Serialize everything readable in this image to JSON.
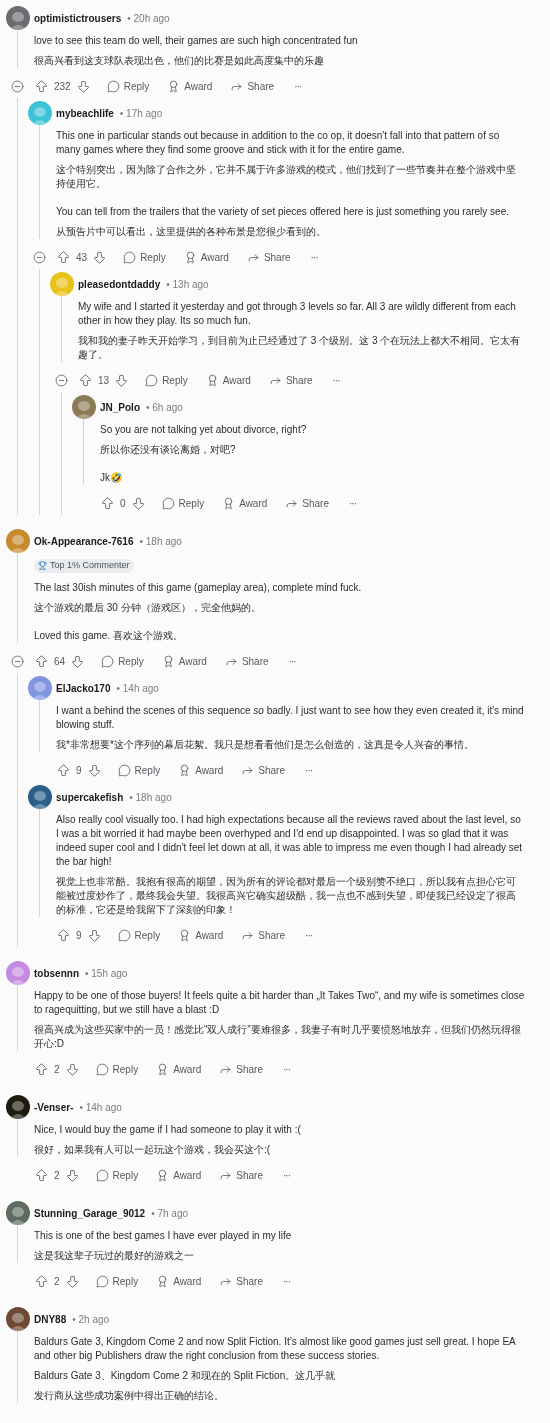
{
  "comments": [
    {
      "user": "optimistictrousers",
      "time": "• 20h ago",
      "color": "#6b6b70",
      "body": [
        [
          "love to see this team do well, their games are such high concentrated fun",
          "很高兴看到这支球队表现出色，他们的比赛是如此高度集中的乐趣"
        ]
      ],
      "actions": {
        "votes": "232",
        "reply": "Reply",
        "award": "Award",
        "share": "Share",
        "more": "···"
      },
      "expanded": true,
      "children": [
        {
          "user": "mybeachlife",
          "time": "• 17h ago",
          "color": "#3cc3d6",
          "body": [
            [
              "This one in particular stands out because in addition to the co op, it doesn't fall into that pattern of so many games where they find some groove and stick with it for the entire game.",
              "这个特别突出，因为除了合作之外，它并不属于许多游戏的模式，他们找到了一些节奏并在整个游戏中坚持使用它。"
            ],
            [
              "You can tell from the trailers that the variety of set pieces offered here is just something you rarely see.",
              "从预告片中可以看出，这里提供的各种布景是您很少看到的。"
            ]
          ],
          "actions": {
            "votes": "43",
            "reply": "Reply",
            "award": "Award",
            "share": "Share",
            "more": "···"
          },
          "expanded": true,
          "children": [
            {
              "user": "pleasedontdaddy",
              "time": "• 13h ago",
              "color": "#e8c21a",
              "body": [
                [
                  "My wife and I started it yesterday and got through 3 levels so far. All 3 are wildly different from each other in how they play. Its so much fun.",
                  "我和我的妻子昨天开始学习，到目前为止已经通过了 3 个级别。这 3 个在玩法上都大不相同。它太有趣了。"
                ]
              ],
              "actions": {
                "votes": "13",
                "reply": "Reply",
                "award": "Award",
                "share": "Share",
                "more": "···"
              },
              "expanded": true,
              "children": [
                {
                  "user": "JN_Polo",
                  "time": "• 6h ago",
                  "color": "#8a7a55",
                  "body": [
                    [
                      "So you are not talking yet about divorce, right?",
                      "所以你还没有谈论离婚，对吧?"
                    ],
                    [
                      "Jk🤣"
                    ]
                  ],
                  "actions": {
                    "votes": "0",
                    "reply": "Reply",
                    "award": "Award",
                    "share": "Share",
                    "more": "···"
                  }
                }
              ]
            }
          ]
        }
      ]
    },
    {
      "user": "Ok-Appearance-7616",
      "time": "• 18h ago",
      "color": "#c98a2e",
      "badge": "Top 1% Commenter",
      "body": [
        [
          "The last 30ish minutes of this game (gameplay area), complete mind fuck.",
          "这个游戏的最后 30 分钟（游戏区），完全他妈的。"
        ],
        [
          "Loved this game.   喜欢这个游戏。"
        ]
      ],
      "actions": {
        "votes": "64",
        "reply": "Reply",
        "award": "Award",
        "share": "Share",
        "more": "···"
      },
      "expanded": true,
      "children": [
        {
          "user": "ElJacko170",
          "time": "• 14h ago",
          "color": "#7f95e0",
          "body": [
            [
              "I want a behind the scenes of this sequence *so* badly. I just want to see how they even created it, it's mind blowing stuff.",
              "我*非常想要*这个序列的幕后花絮。我只是想看看他们是怎么创造的，这真是令人兴奋的事情。"
            ]
          ],
          "actions": {
            "votes": "9",
            "reply": "Reply",
            "award": "Award",
            "share": "Share",
            "more": "···"
          }
        },
        {
          "user": "supercakefish",
          "time": "• 18h ago",
          "color": "#2b5f8a",
          "body": [
            [
              "Also really cool visually too. I had high expectations because all the reviews raved about the last level, so I was a bit worried it had maybe been overhyped and I'd end up disappointed. I was so glad that it was indeed super cool and I didn't feel let down at all, it was able to impress me even though I had already set the bar high!",
              "视觉上也非常酷。我抱有很高的期望，因为所有的评论都对最后一个级别赞不绝口，所以我有点担心它可能被过度炒作了，最终我会失望。我很高兴它确实超级酷，我一点也不感到失望，即使我已经设定了很高的标准，它还是给我留下了深刻的印象！"
            ]
          ],
          "actions": {
            "votes": "9",
            "reply": "Reply",
            "award": "Award",
            "share": "Share",
            "more": "···"
          }
        }
      ]
    },
    {
      "user": "tobsennn",
      "time": "• 15h ago",
      "color": "#c58be0",
      "body": [
        [
          "Happy to be one of those buyers! It feels quite a bit harder than „It Takes Two“, and my wife is sometimes close to ragequitting, but we still have a blast :D",
          "很高兴成为这些买家中的一员！感觉比“双人成行”要难很多，我妻子有时几乎要愤怒地放弃，但我们仍然玩得很开心:D"
        ]
      ],
      "actions": {
        "votes": "2",
        "reply": "Reply",
        "award": "Award",
        "share": "Share",
        "more": "···"
      }
    },
    {
      "user": "-Venser-",
      "time": "• 14h ago",
      "color": "#1d1a10",
      "body": [
        [
          "Nice, I would buy the game if I had someone to play it with :(",
          "很好，如果我有人可以一起玩这个游戏，我会买这个:("
        ]
      ],
      "actions": {
        "votes": "2",
        "reply": "Reply",
        "award": "Award",
        "share": "Share",
        "more": "···"
      }
    },
    {
      "user": "Stunning_Garage_9012",
      "time": "• 7h ago",
      "color": "#5d6b60",
      "body": [
        [
          "This is one of the best games I have ever played in my life",
          "这是我这辈子玩过的最好的游戏之一"
        ]
      ],
      "actions": {
        "votes": "2",
        "reply": "Reply",
        "award": "Award",
        "share": "Share",
        "more": "···"
      }
    },
    {
      "user": "DNY88",
      "time": "• 2h ago",
      "color": "#6e4a34",
      "body": [
        [
          "Baldurs Gate 3, Kingdom Come 2 and now Split Fiction. It’s almost like good games just sell great. I hope EA and other big Publishers draw the right conclusion from these success stories.",
          "Baldurs Gate 3、Kingdom Come 2 和现在的 Split Fiction。这几乎就",
          "发行商从这些成功案例中得出正确的结论。"
        ]
      ]
    }
  ]
}
